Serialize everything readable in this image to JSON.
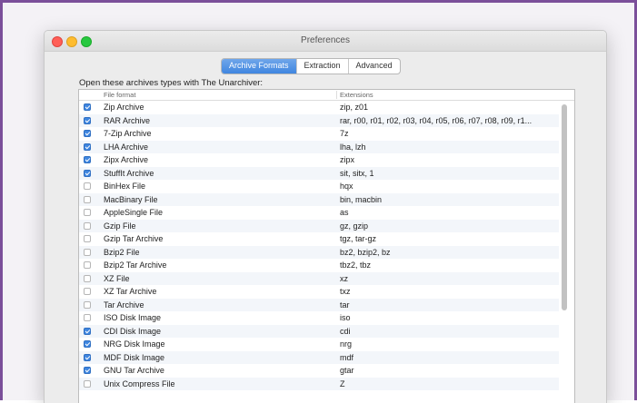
{
  "window": {
    "title": "Preferences"
  },
  "tabs": [
    {
      "label": "Archive Formats",
      "active": true
    },
    {
      "label": "Extraction",
      "active": false
    },
    {
      "label": "Advanced",
      "active": false
    }
  ],
  "subtitle": "Open these archives types with The Unarchiver:",
  "table": {
    "columns": [
      "File format",
      "Extensions"
    ],
    "rows": [
      {
        "checked": true,
        "format": "Zip Archive",
        "ext": "zip, z01"
      },
      {
        "checked": true,
        "format": "RAR Archive",
        "ext": "rar, r00, r01, r02, r03, r04, r05, r06, r07, r08, r09, r1..."
      },
      {
        "checked": true,
        "format": "7-Zip Archive",
        "ext": "7z"
      },
      {
        "checked": true,
        "format": "LHA Archive",
        "ext": "lha, lzh"
      },
      {
        "checked": true,
        "format": "Zipx Archive",
        "ext": "zipx"
      },
      {
        "checked": true,
        "format": "StuffIt Archive",
        "ext": "sit, sitx, 1"
      },
      {
        "checked": false,
        "format": "BinHex File",
        "ext": "hqx"
      },
      {
        "checked": false,
        "format": "MacBinary File",
        "ext": "bin, macbin"
      },
      {
        "checked": false,
        "format": "AppleSingle File",
        "ext": "as"
      },
      {
        "checked": false,
        "format": "Gzip File",
        "ext": "gz, gzip"
      },
      {
        "checked": false,
        "format": "Gzip Tar Archive",
        "ext": "tgz, tar-gz"
      },
      {
        "checked": false,
        "format": "Bzip2 File",
        "ext": "bz2, bzip2, bz"
      },
      {
        "checked": false,
        "format": "Bzip2 Tar Archive",
        "ext": "tbz2, tbz"
      },
      {
        "checked": false,
        "format": "XZ File",
        "ext": "xz"
      },
      {
        "checked": false,
        "format": "XZ Tar Archive",
        "ext": "txz"
      },
      {
        "checked": false,
        "format": "Tar Archive",
        "ext": "tar"
      },
      {
        "checked": false,
        "format": "ISO Disk Image",
        "ext": "iso"
      },
      {
        "checked": true,
        "format": "CDI Disk Image",
        "ext": "cdi"
      },
      {
        "checked": true,
        "format": "NRG Disk Image",
        "ext": "nrg"
      },
      {
        "checked": true,
        "format": "MDF Disk Image",
        "ext": "mdf"
      },
      {
        "checked": true,
        "format": "GNU Tar Archive",
        "ext": "gtar"
      },
      {
        "checked": false,
        "format": "Unix Compress File",
        "ext": "Z"
      }
    ]
  },
  "colors": {
    "frame": "#7b4f9a",
    "accent": "#3f86e0"
  }
}
